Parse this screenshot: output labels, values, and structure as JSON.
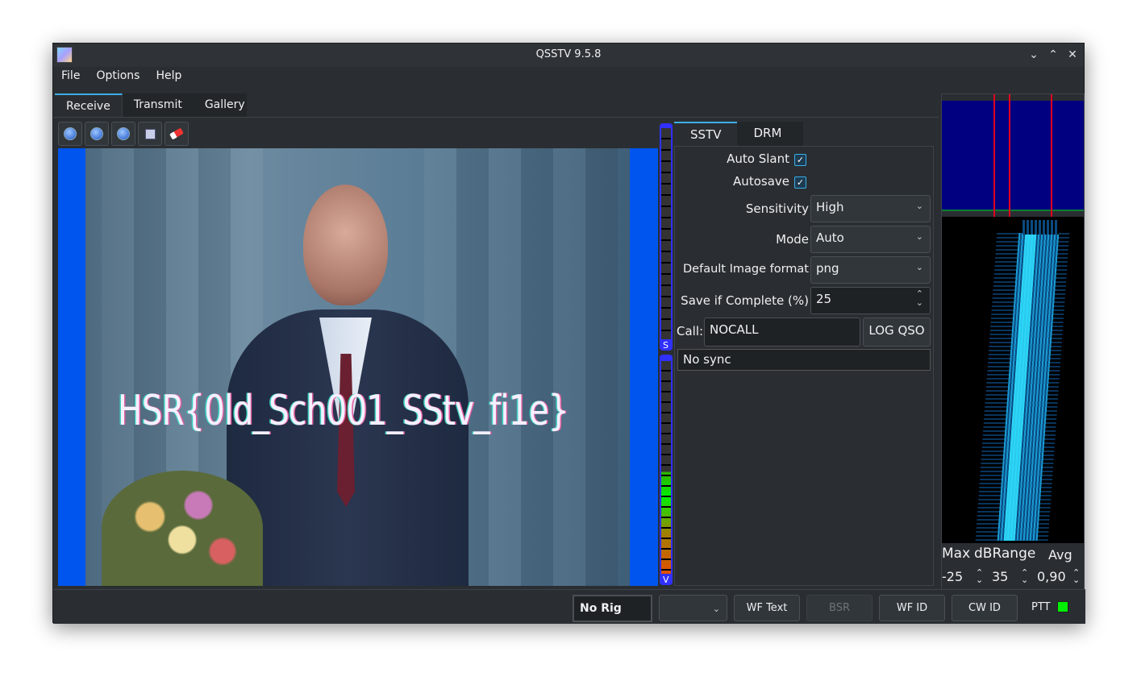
{
  "window": {
    "title": "QSSTV 9.5.8",
    "controls": [
      "minimize",
      "maximize",
      "close"
    ]
  },
  "menu": [
    "File",
    "Options",
    "Help"
  ],
  "tabs": [
    {
      "label": "Receive",
      "active": true
    },
    {
      "label": "Transmit"
    },
    {
      "label": "Gallery"
    }
  ],
  "toolbar": [
    "start-icon",
    "stop-icon",
    "resync-icon",
    "save-icon",
    "erase-icon"
  ],
  "image": {
    "overlay_text": "HSR{0ld_Sch001_SStv_fi1e}"
  },
  "vu": {
    "sync_label": "S",
    "volume_label": "V",
    "volume_level": 0.48
  },
  "panel": {
    "tabs": [
      {
        "label": "SSTV",
        "active": true
      },
      {
        "label": "DRM"
      }
    ],
    "auto_slant": {
      "label": "Auto Slant",
      "checked": true
    },
    "autosave": {
      "label": "Autosave",
      "checked": true
    },
    "sensitivity": {
      "label": "Sensitivity",
      "value": "High"
    },
    "mode": {
      "label": "Mode",
      "value": "Auto"
    },
    "format": {
      "label": "Default Image format",
      "value": "png"
    },
    "save_complete": {
      "label": "Save if Complete (%)",
      "value": "25"
    },
    "call": {
      "label": "Call:",
      "value": "NOCALL"
    },
    "log_qso": "LOG QSO",
    "status": "No sync"
  },
  "waterfall": {
    "max_label": "Max",
    "range_label": "dBRange",
    "avg_label": "Avg",
    "max": "-25",
    "range": "35",
    "avg": "0,90"
  },
  "statusbar": {
    "rig": "No Rig",
    "combo": "",
    "wf_text": "WF Text",
    "bsr": "BSR",
    "wf_id": "WF ID",
    "cw_id": "CW ID",
    "ptt": "PTT",
    "ptt_color": "#00ee00"
  },
  "colors": {
    "accent": "#3daee9",
    "image_bg": "#0055ee",
    "spectrum_bg": "#000080"
  }
}
